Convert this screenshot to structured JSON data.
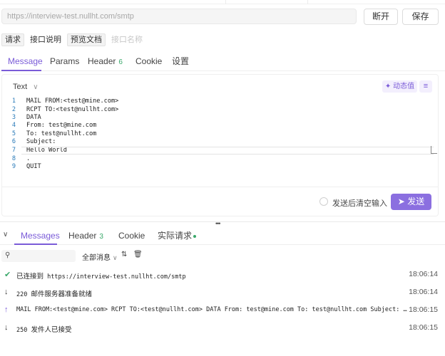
{
  "url": {
    "value": "https://interview-test.nullht.com/smtp"
  },
  "toolbar": {
    "disconnect_label": "断开",
    "save_label": "保存"
  },
  "doc_tabs": {
    "request": "请求",
    "api_doc": "接口说明",
    "preview_doc": "预览文档",
    "name_placeholder": "接口名称"
  },
  "request_tabs": {
    "message": "Message",
    "params": "Params",
    "header": "Header",
    "header_count": "6",
    "cookie": "Cookie",
    "settings": "设置"
  },
  "editor": {
    "format": "Text",
    "dynamic_value_label": "动态值",
    "lines": [
      {
        "num": "1",
        "text": "MAIL FROM:<test@mine.com>"
      },
      {
        "num": "2",
        "text": "RCPT TO:<test@nullht.com>"
      },
      {
        "num": "3",
        "text": "DATA"
      },
      {
        "num": "4",
        "text": "From: test@mine.com"
      },
      {
        "num": "5",
        "text": "To: test@nullht.com"
      },
      {
        "num": "6",
        "text": "Subject:"
      },
      {
        "num": "7",
        "text": "Hello World"
      },
      {
        "num": "8",
        "text": "."
      },
      {
        "num": "9",
        "text": "QUIT"
      }
    ]
  },
  "send": {
    "clear_after_send_label": "发送后清空输入",
    "send_label": "发送"
  },
  "response_tabs": {
    "messages": "Messages",
    "header": "Header",
    "header_count": "3",
    "cookie": "Cookie",
    "actual_request": "实际请求"
  },
  "filter": {
    "type_label": "全部消息"
  },
  "messages": [
    {
      "icon": "check-circle",
      "direction": "status",
      "prefix": "已连接到",
      "text": " https://interview-test.nullht.com/smtp",
      "time": "18:06:14"
    },
    {
      "icon": "arrow-down",
      "direction": "received",
      "prefix": "220 ",
      "text": "邮件服务器准备就绪",
      "time": "18:06:14"
    },
    {
      "icon": "arrow-up",
      "direction": "sent",
      "prefix": "",
      "text": "MAIL FROM:<test@mine.com> RCPT TO:<test@nullht.com> DATA From: test@mine.com To: test@nullht.com Subject: Hello ...",
      "time": "18:06:15"
    },
    {
      "icon": "arrow-down",
      "direction": "received",
      "prefix": "250 ",
      "text": "发件人已接受",
      "time": "18:06:15"
    }
  ],
  "colors": {
    "accent": "#7a5bd8",
    "send_button": "#8b6fe0",
    "success": "#3aa86a"
  }
}
